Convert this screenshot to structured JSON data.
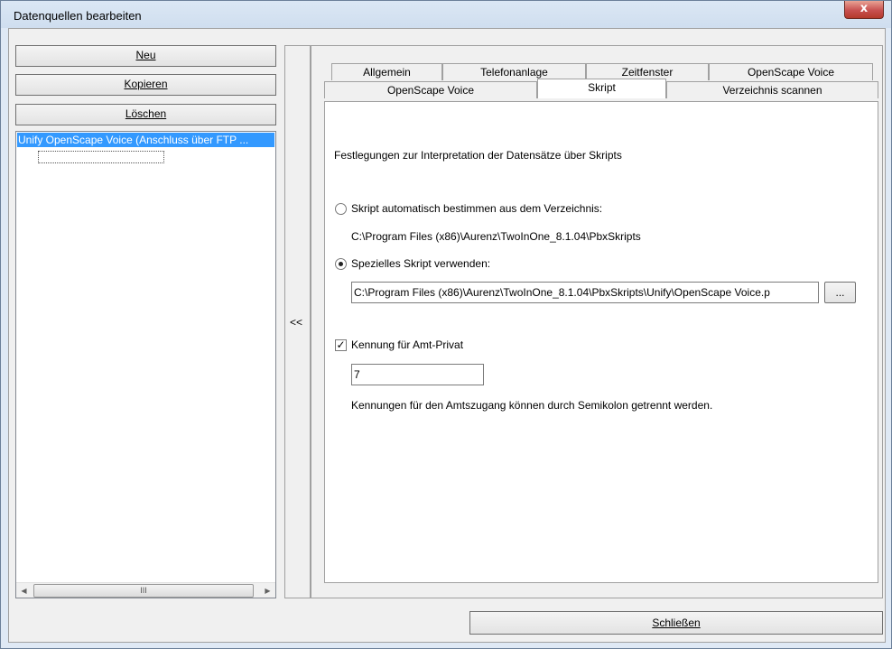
{
  "window": {
    "title": "Datenquellen bearbeiten",
    "close_label": "x"
  },
  "left": {
    "new_label": "Neu",
    "copy_label": "Kopieren",
    "delete_label": "Löschen",
    "list_items": [
      "Unify OpenScape Voice (Anschluss über FTP ..."
    ],
    "hscroll_thumb": "III"
  },
  "splitter": {
    "collapse_label": "<<"
  },
  "tabs": {
    "row1": [
      "Allgemein",
      "Telefonanlage",
      "Zeitfenster",
      "OpenScape Voice"
    ],
    "row2": [
      "OpenScape Voice",
      "Skript",
      "Verzeichnis scannen"
    ],
    "active": "Skript"
  },
  "script_page": {
    "heading": "Festlegungen zur Interpretation der Datensätze über Skripts",
    "radio_auto_label": "Skript automatisch bestimmen aus dem Verzeichnis:",
    "auto_path": "C:\\Program Files (x86)\\Aurenz\\TwoInOne_8.1.04\\PbxSkripts",
    "radio_special_label": "Spezielles Skript verwenden:",
    "special_path": "C:\\Program Files (x86)\\Aurenz\\TwoInOne_8.1.04\\PbxSkripts\\Unify\\OpenScape Voice.p",
    "browse_label": "...",
    "checkbox_label": "Kennung für Amt-Privat",
    "checkbox_checked": true,
    "code_value": "7",
    "hint": "Kennungen für den Amtszugang können durch Semikolon getrennt werden."
  },
  "footer": {
    "close_label": "Schließen"
  }
}
